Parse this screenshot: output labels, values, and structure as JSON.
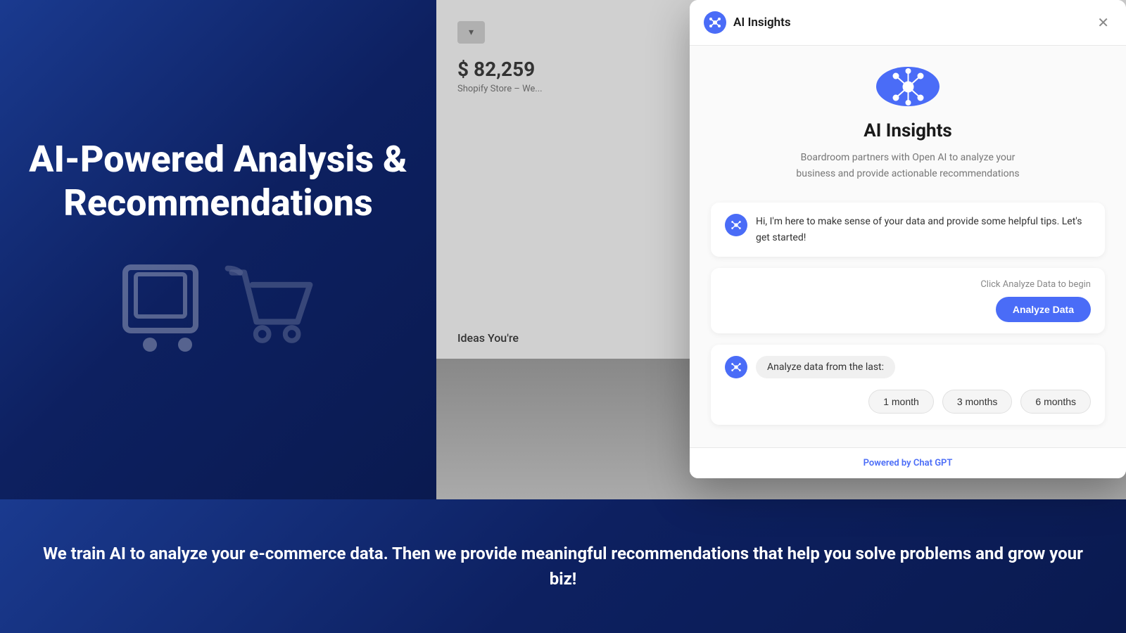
{
  "leftPanel": {
    "title": "AI-Powered Analysis & Recommendations"
  },
  "backgroundPanel": {
    "dropdown": "▾",
    "amount": "$ 82,259",
    "subtitle": "Shopify Store – We...",
    "ideasText": "Ideas You're"
  },
  "dialog": {
    "headerTitle": "AI Insights",
    "closeLabel": "✕",
    "mainTitle": "AI Insights",
    "description": "Boardroom partners with Open AI to analyze your business and provide actionable recommendations",
    "chatMessage1": "Hi, I'm here to make sense of your data and provide some helpful tips. Let's get started!",
    "clickHint": "Click Analyze Data to begin",
    "analyzeButtonLabel": "Analyze Data",
    "analyzePrompt": "Analyze data from the last:",
    "timeOptions": [
      "1 month",
      "3 months",
      "6 months"
    ],
    "footerText": "Powered by ",
    "footerBrand": "Chat GPT"
  },
  "bottomBanner": {
    "text": "We train AI to analyze your e-commerce data. Then we provide meaningful recommendations that help you solve problems and grow your biz!"
  }
}
